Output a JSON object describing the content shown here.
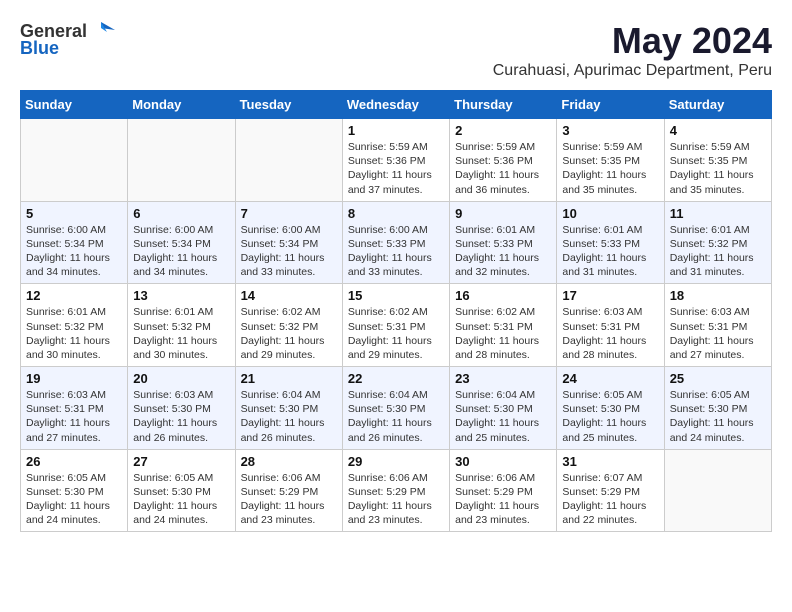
{
  "header": {
    "logo_general": "General",
    "logo_blue": "Blue",
    "month_title": "May 2024",
    "subtitle": "Curahuasi, Apurimac Department, Peru"
  },
  "weekdays": [
    "Sunday",
    "Monday",
    "Tuesday",
    "Wednesday",
    "Thursday",
    "Friday",
    "Saturday"
  ],
  "weeks": [
    [
      {
        "day": "",
        "info": ""
      },
      {
        "day": "",
        "info": ""
      },
      {
        "day": "",
        "info": ""
      },
      {
        "day": "1",
        "info": "Sunrise: 5:59 AM\nSunset: 5:36 PM\nDaylight: 11 hours and 37 minutes."
      },
      {
        "day": "2",
        "info": "Sunrise: 5:59 AM\nSunset: 5:36 PM\nDaylight: 11 hours and 36 minutes."
      },
      {
        "day": "3",
        "info": "Sunrise: 5:59 AM\nSunset: 5:35 PM\nDaylight: 11 hours and 35 minutes."
      },
      {
        "day": "4",
        "info": "Sunrise: 5:59 AM\nSunset: 5:35 PM\nDaylight: 11 hours and 35 minutes."
      }
    ],
    [
      {
        "day": "5",
        "info": "Sunrise: 6:00 AM\nSunset: 5:34 PM\nDaylight: 11 hours and 34 minutes."
      },
      {
        "day": "6",
        "info": "Sunrise: 6:00 AM\nSunset: 5:34 PM\nDaylight: 11 hours and 34 minutes."
      },
      {
        "day": "7",
        "info": "Sunrise: 6:00 AM\nSunset: 5:34 PM\nDaylight: 11 hours and 33 minutes."
      },
      {
        "day": "8",
        "info": "Sunrise: 6:00 AM\nSunset: 5:33 PM\nDaylight: 11 hours and 33 minutes."
      },
      {
        "day": "9",
        "info": "Sunrise: 6:01 AM\nSunset: 5:33 PM\nDaylight: 11 hours and 32 minutes."
      },
      {
        "day": "10",
        "info": "Sunrise: 6:01 AM\nSunset: 5:33 PM\nDaylight: 11 hours and 31 minutes."
      },
      {
        "day": "11",
        "info": "Sunrise: 6:01 AM\nSunset: 5:32 PM\nDaylight: 11 hours and 31 minutes."
      }
    ],
    [
      {
        "day": "12",
        "info": "Sunrise: 6:01 AM\nSunset: 5:32 PM\nDaylight: 11 hours and 30 minutes."
      },
      {
        "day": "13",
        "info": "Sunrise: 6:01 AM\nSunset: 5:32 PM\nDaylight: 11 hours and 30 minutes."
      },
      {
        "day": "14",
        "info": "Sunrise: 6:02 AM\nSunset: 5:32 PM\nDaylight: 11 hours and 29 minutes."
      },
      {
        "day": "15",
        "info": "Sunrise: 6:02 AM\nSunset: 5:31 PM\nDaylight: 11 hours and 29 minutes."
      },
      {
        "day": "16",
        "info": "Sunrise: 6:02 AM\nSunset: 5:31 PM\nDaylight: 11 hours and 28 minutes."
      },
      {
        "day": "17",
        "info": "Sunrise: 6:03 AM\nSunset: 5:31 PM\nDaylight: 11 hours and 28 minutes."
      },
      {
        "day": "18",
        "info": "Sunrise: 6:03 AM\nSunset: 5:31 PM\nDaylight: 11 hours and 27 minutes."
      }
    ],
    [
      {
        "day": "19",
        "info": "Sunrise: 6:03 AM\nSunset: 5:31 PM\nDaylight: 11 hours and 27 minutes."
      },
      {
        "day": "20",
        "info": "Sunrise: 6:03 AM\nSunset: 5:30 PM\nDaylight: 11 hours and 26 minutes."
      },
      {
        "day": "21",
        "info": "Sunrise: 6:04 AM\nSunset: 5:30 PM\nDaylight: 11 hours and 26 minutes."
      },
      {
        "day": "22",
        "info": "Sunrise: 6:04 AM\nSunset: 5:30 PM\nDaylight: 11 hours and 26 minutes."
      },
      {
        "day": "23",
        "info": "Sunrise: 6:04 AM\nSunset: 5:30 PM\nDaylight: 11 hours and 25 minutes."
      },
      {
        "day": "24",
        "info": "Sunrise: 6:05 AM\nSunset: 5:30 PM\nDaylight: 11 hours and 25 minutes."
      },
      {
        "day": "25",
        "info": "Sunrise: 6:05 AM\nSunset: 5:30 PM\nDaylight: 11 hours and 24 minutes."
      }
    ],
    [
      {
        "day": "26",
        "info": "Sunrise: 6:05 AM\nSunset: 5:30 PM\nDaylight: 11 hours and 24 minutes."
      },
      {
        "day": "27",
        "info": "Sunrise: 6:05 AM\nSunset: 5:30 PM\nDaylight: 11 hours and 24 minutes."
      },
      {
        "day": "28",
        "info": "Sunrise: 6:06 AM\nSunset: 5:29 PM\nDaylight: 11 hours and 23 minutes."
      },
      {
        "day": "29",
        "info": "Sunrise: 6:06 AM\nSunset: 5:29 PM\nDaylight: 11 hours and 23 minutes."
      },
      {
        "day": "30",
        "info": "Sunrise: 6:06 AM\nSunset: 5:29 PM\nDaylight: 11 hours and 23 minutes."
      },
      {
        "day": "31",
        "info": "Sunrise: 6:07 AM\nSunset: 5:29 PM\nDaylight: 11 hours and 22 minutes."
      },
      {
        "day": "",
        "info": ""
      }
    ]
  ]
}
